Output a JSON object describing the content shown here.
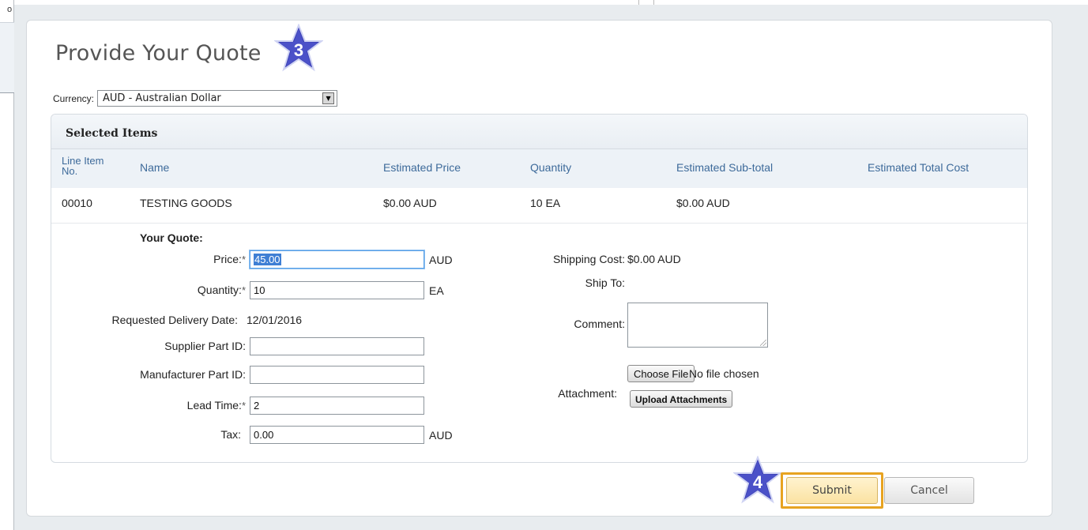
{
  "background": {
    "left_fragment": "o"
  },
  "page": {
    "title": "Provide Your Quote",
    "step_badges": [
      "3",
      "4"
    ]
  },
  "currency": {
    "label": "Currency:",
    "selected": "AUD - Australian Dollar"
  },
  "selected_items": {
    "heading": "Selected Items",
    "columns": [
      "Line Item No.",
      "Name",
      "Estimated Price",
      "Quantity",
      "Estimated Sub-total",
      "Estimated Total Cost"
    ],
    "rows": [
      {
        "line_no": "00010",
        "name": "TESTING GOODS",
        "estimated_price": "$0.00 AUD",
        "quantity": "10 EA",
        "estimated_subtotal": "$0.00 AUD",
        "estimated_total": ""
      }
    ]
  },
  "quote": {
    "heading": "Your Quote:",
    "required_mark": "*",
    "price": {
      "label": "Price:",
      "value": "45.00",
      "unit": "AUD"
    },
    "quantity": {
      "label": "Quantity:",
      "value": "10",
      "unit": "EA"
    },
    "requested_delivery": {
      "label": "Requested Delivery Date:",
      "value": "12/01/2016"
    },
    "supplier_part_id": {
      "label": "Supplier Part ID:",
      "value": ""
    },
    "manufacturer_part_id": {
      "label": "Manufacturer Part ID:",
      "value": ""
    },
    "lead_time": {
      "label": "Lead Time:",
      "value": "2"
    },
    "tax": {
      "label": "Tax:",
      "value": "0.00",
      "unit": "AUD"
    },
    "shipping_cost": {
      "label": "Shipping Cost:",
      "value": "$0.00 AUD"
    },
    "ship_to": {
      "label": "Ship To:",
      "value": ""
    },
    "comment": {
      "label": "Comment:",
      "value": ""
    },
    "attachment": {
      "label": "Attachment:",
      "choose_file": "Choose File",
      "file_status": "No file chosen",
      "upload": "Upload Attachments"
    }
  },
  "actions": {
    "submit": "Submit",
    "cancel": "Cancel"
  },
  "colors": {
    "header_text": "#3d6a9a",
    "badge_star": "#3b3fb4",
    "submit_highlight": "#e7a321"
  }
}
